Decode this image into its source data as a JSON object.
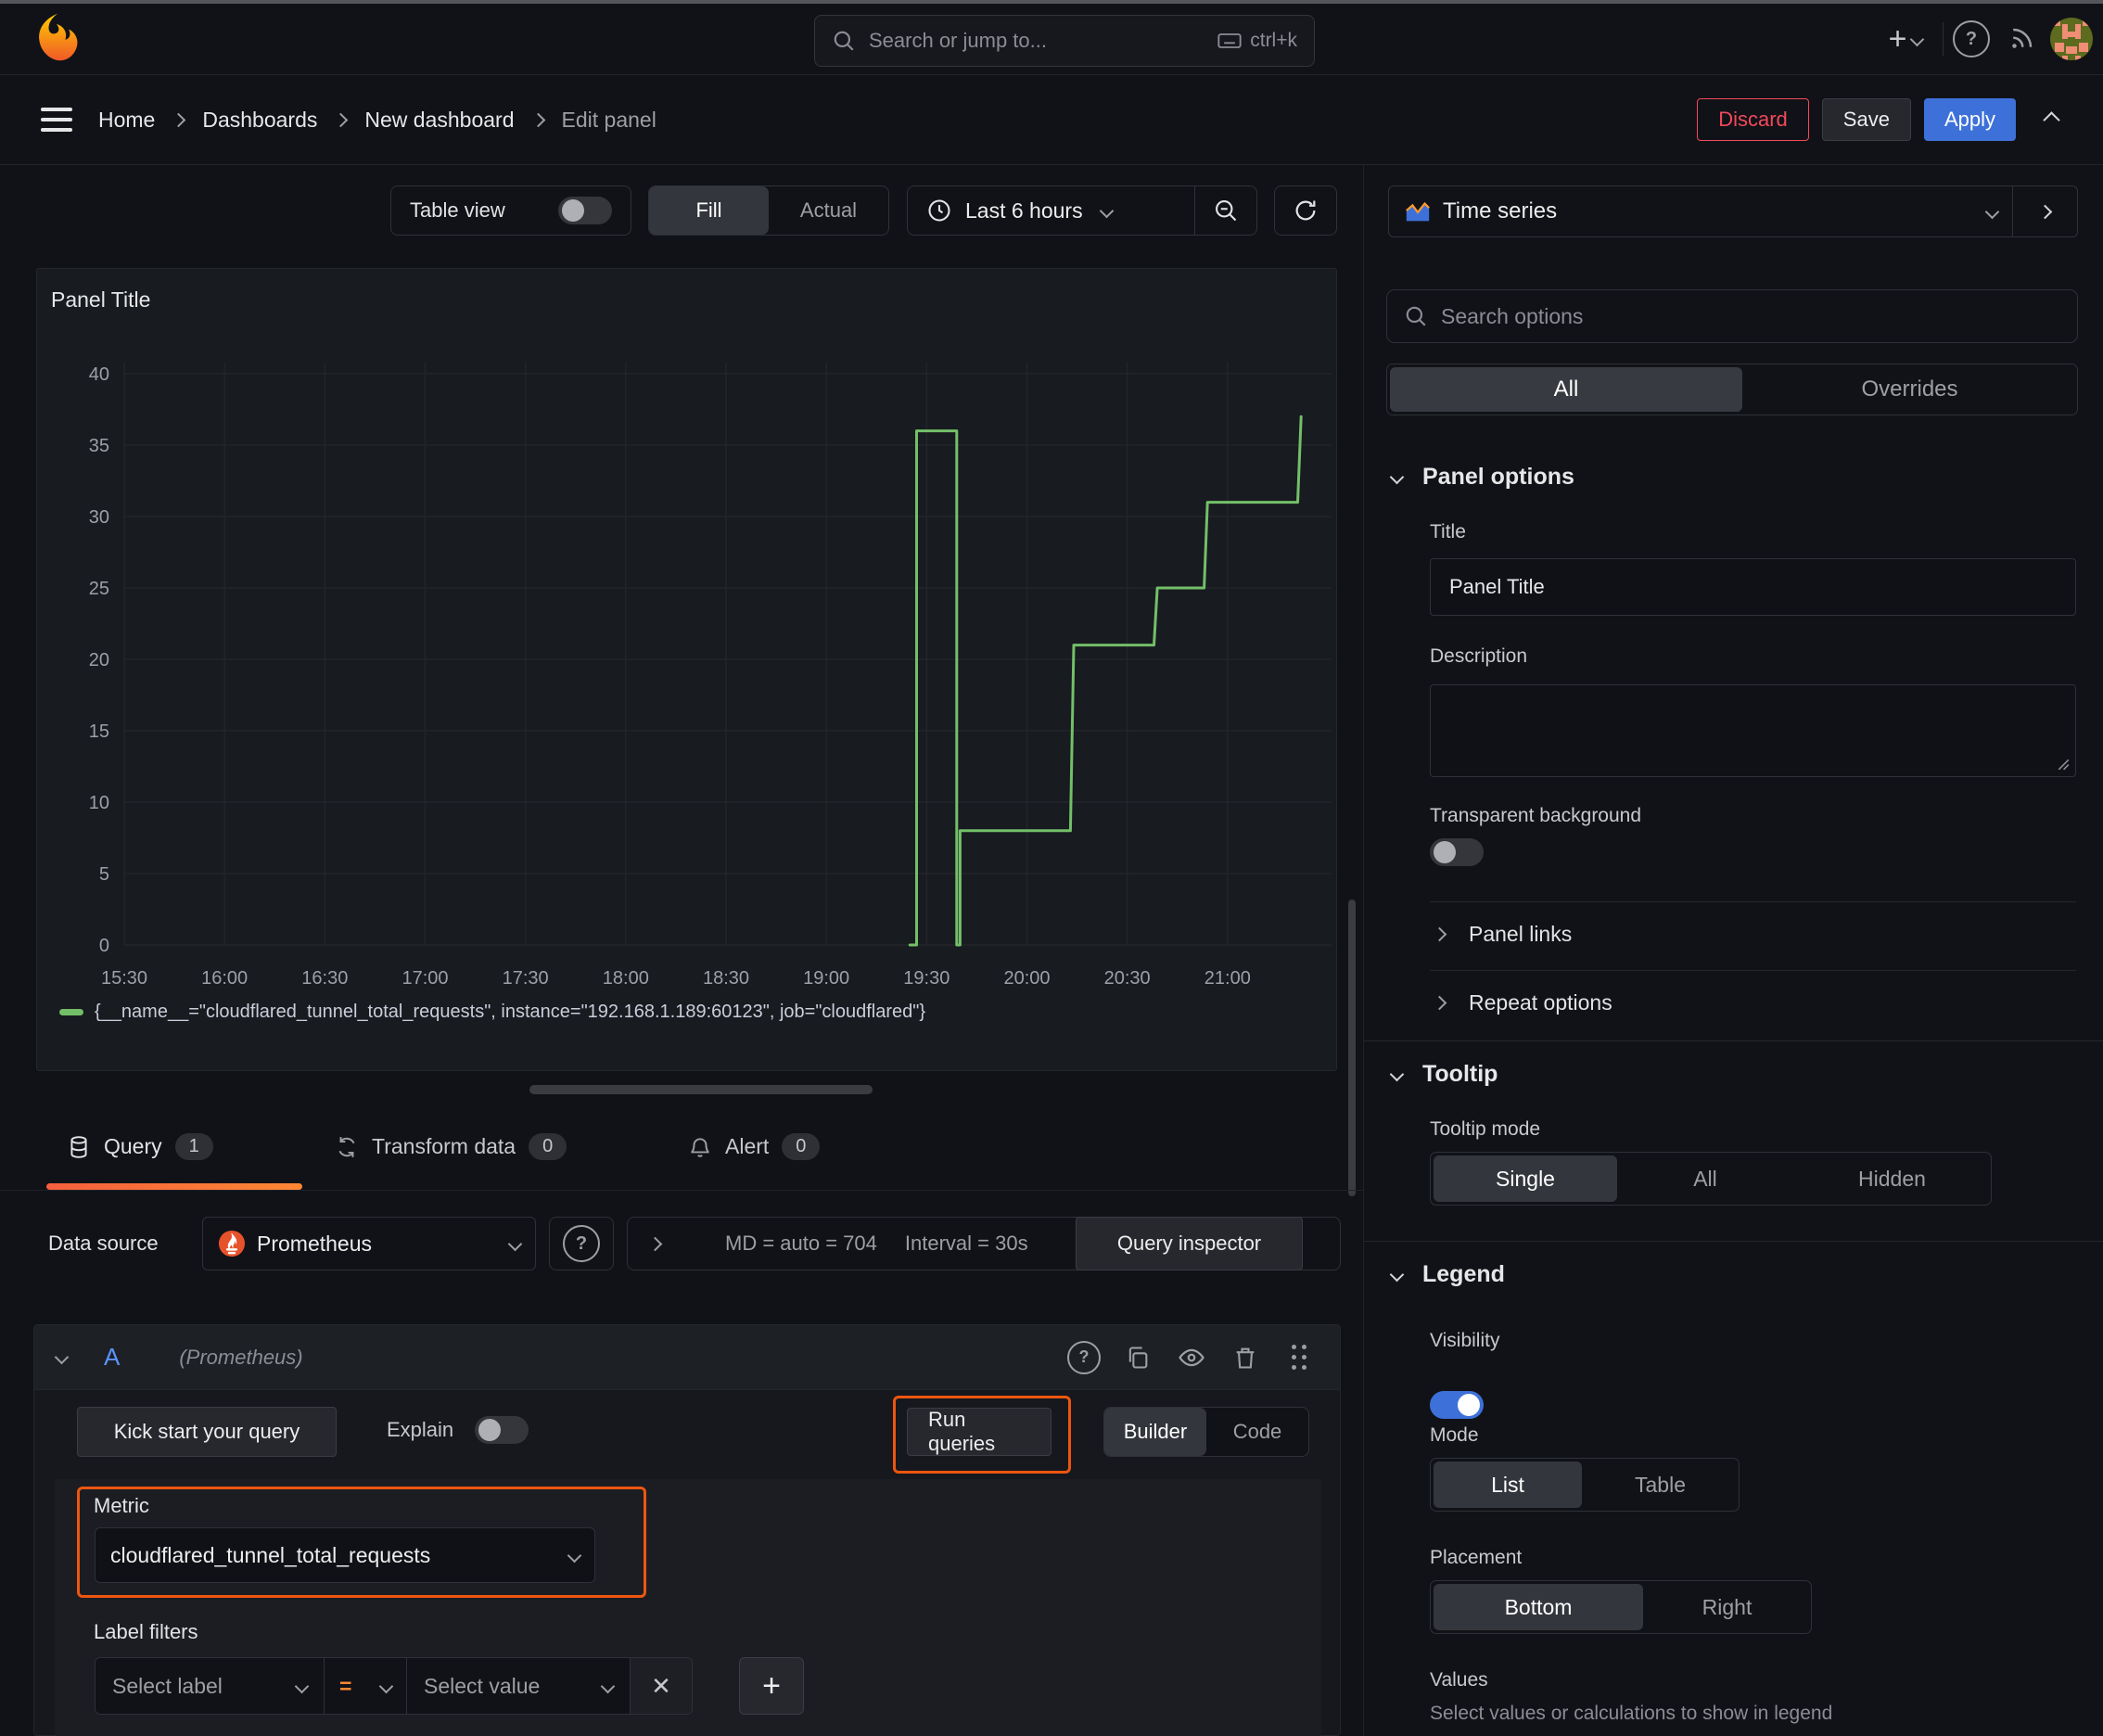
{
  "topnav": {
    "search": {
      "placeholder": "Search or jump to...",
      "shortcut": "ctrl+k"
    }
  },
  "breadcrumb": {
    "items": [
      "Home",
      "Dashboards",
      "New dashboard",
      "Edit panel"
    ]
  },
  "header_actions": {
    "discard": "Discard",
    "save": "Save",
    "apply": "Apply"
  },
  "toolbar": {
    "table_view": "Table view",
    "fill": "Fill",
    "actual": "Actual",
    "time_range": "Last 6 hours"
  },
  "panel": {
    "title": "Panel Title",
    "legend": "{__name__=\"cloudflared_tunnel_total_requests\", instance=\"192.168.1.189:60123\", job=\"cloudflared\"}"
  },
  "chart_data": {
    "type": "line",
    "title": "Panel Title",
    "x_ticks": [
      "15:30",
      "16:00",
      "16:30",
      "17:00",
      "17:30",
      "18:00",
      "18:30",
      "19:00",
      "19:30",
      "20:00",
      "20:30",
      "21:00"
    ],
    "x_tick_interval_minutes": 30,
    "x_minutes_range": [
      0,
      360
    ],
    "y_ticks": [
      0,
      5,
      10,
      15,
      20,
      25,
      30,
      35,
      40
    ],
    "ylim": [
      0,
      40
    ],
    "grid": true,
    "legend_position": "bottom",
    "series": [
      {
        "name": "{__name__=\"cloudflared_tunnel_total_requests\", instance=\"192.168.1.189:60123\", job=\"cloudflared\"}",
        "color": "#73bf69",
        "points_min_val": [
          [
            235,
            0
          ],
          [
            237,
            0
          ],
          [
            237,
            36
          ],
          [
            249,
            36
          ],
          [
            249,
            0
          ],
          [
            250,
            0
          ],
          [
            250,
            8
          ],
          [
            283,
            8
          ],
          [
            284,
            21
          ],
          [
            308,
            21
          ],
          [
            309,
            25
          ],
          [
            323,
            25
          ],
          [
            324,
            31
          ],
          [
            351,
            31
          ],
          [
            352,
            37
          ]
        ]
      }
    ]
  },
  "query_tabs": {
    "query": "Query",
    "query_count": "1",
    "transform": "Transform data",
    "transform_count": "0",
    "alert": "Alert",
    "alert_count": "0"
  },
  "datasource_row": {
    "label": "Data source",
    "name": "Prometheus",
    "stats_md": "MD = auto = 704",
    "stats_interval": "Interval = 30s",
    "inspector": "Query inspector"
  },
  "query_editor": {
    "ref_id": "A",
    "ds_hint": "(Prometheus)",
    "kick_start": "Kick start your query",
    "explain": "Explain",
    "run_queries": "Run queries",
    "builder": "Builder",
    "code": "Code",
    "metric_label": "Metric",
    "metric_value": "cloudflared_tunnel_total_requests",
    "label_filters": "Label filters",
    "select_label": "Select label",
    "operator": "=",
    "select_value": "Select value"
  },
  "sidebar": {
    "viz_name": "Time series",
    "search_placeholder": "Search options",
    "tabs": {
      "all": "All",
      "overrides": "Overrides"
    },
    "panel_options": {
      "title": "Panel options",
      "title_label": "Title",
      "title_value": "Panel Title",
      "description_label": "Description",
      "transparent_label": "Transparent background"
    },
    "links_label": "Panel links",
    "repeat_label": "Repeat options",
    "tooltip": {
      "title": "Tooltip",
      "mode_label": "Tooltip mode",
      "modes": [
        "Single",
        "All",
        "Hidden"
      ]
    },
    "legend": {
      "title": "Legend",
      "visibility_label": "Visibility",
      "mode_label": "Mode",
      "modes": [
        "List",
        "Table"
      ],
      "placement_label": "Placement",
      "placements": [
        "Bottom",
        "Right"
      ],
      "values_label": "Values",
      "values_desc": "Select values or calculations to show in legend"
    }
  },
  "colors": {
    "accent_orange": "#ed560f",
    "series_green": "#73bf69",
    "primary_blue": "#3d71d9",
    "danger_red": "#f2495c",
    "tab_underline_from": "#f55f3e",
    "tab_underline_to": "#ff8833"
  }
}
